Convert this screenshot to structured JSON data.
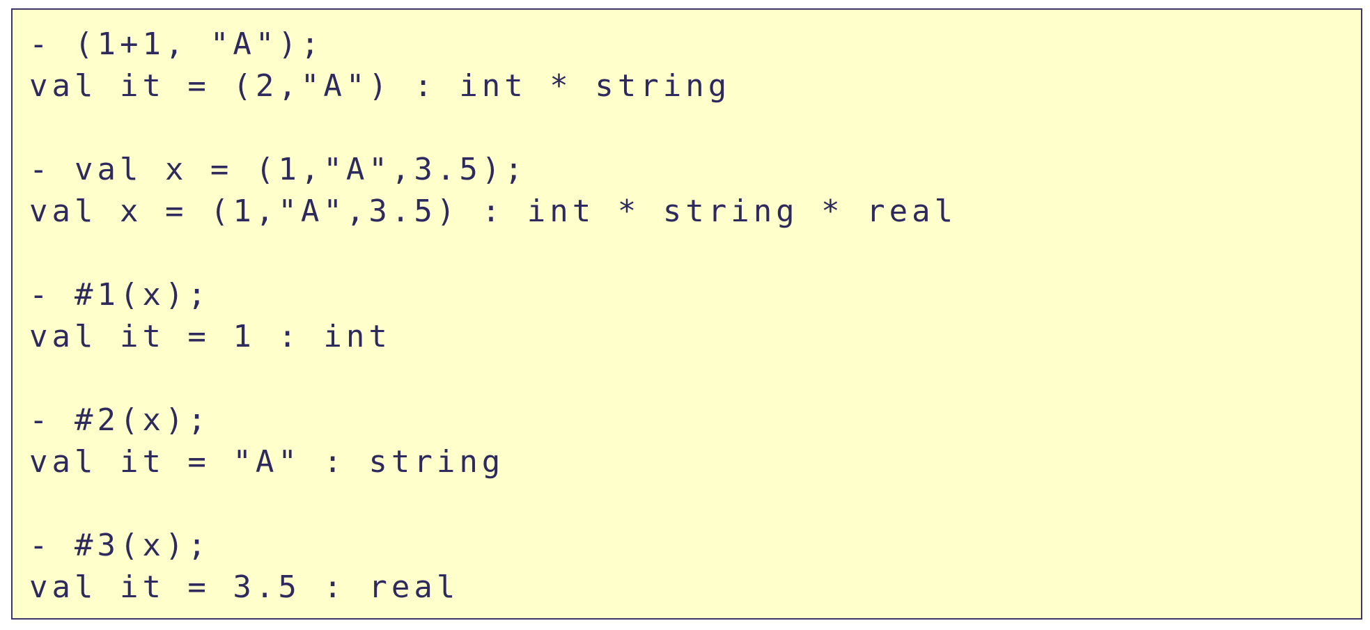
{
  "colors": {
    "background": "#ffffcc",
    "border": "#3b3568",
    "text": "#2e2a5e"
  },
  "session": [
    {
      "input": "- (1+1, \"A\");",
      "output": "val it = (2,\"A\") : int * string"
    },
    {
      "input": "- val x = (1,\"A\",3.5);",
      "output": "val x = (1,\"A\",3.5) : int * string * real"
    },
    {
      "input": "- #1(x);",
      "output": "val it = 1 : int"
    },
    {
      "input": "- #2(x);",
      "output": "val it = \"A\" : string"
    },
    {
      "input": "- #3(x);",
      "output": "val it = 3.5 : real"
    }
  ]
}
